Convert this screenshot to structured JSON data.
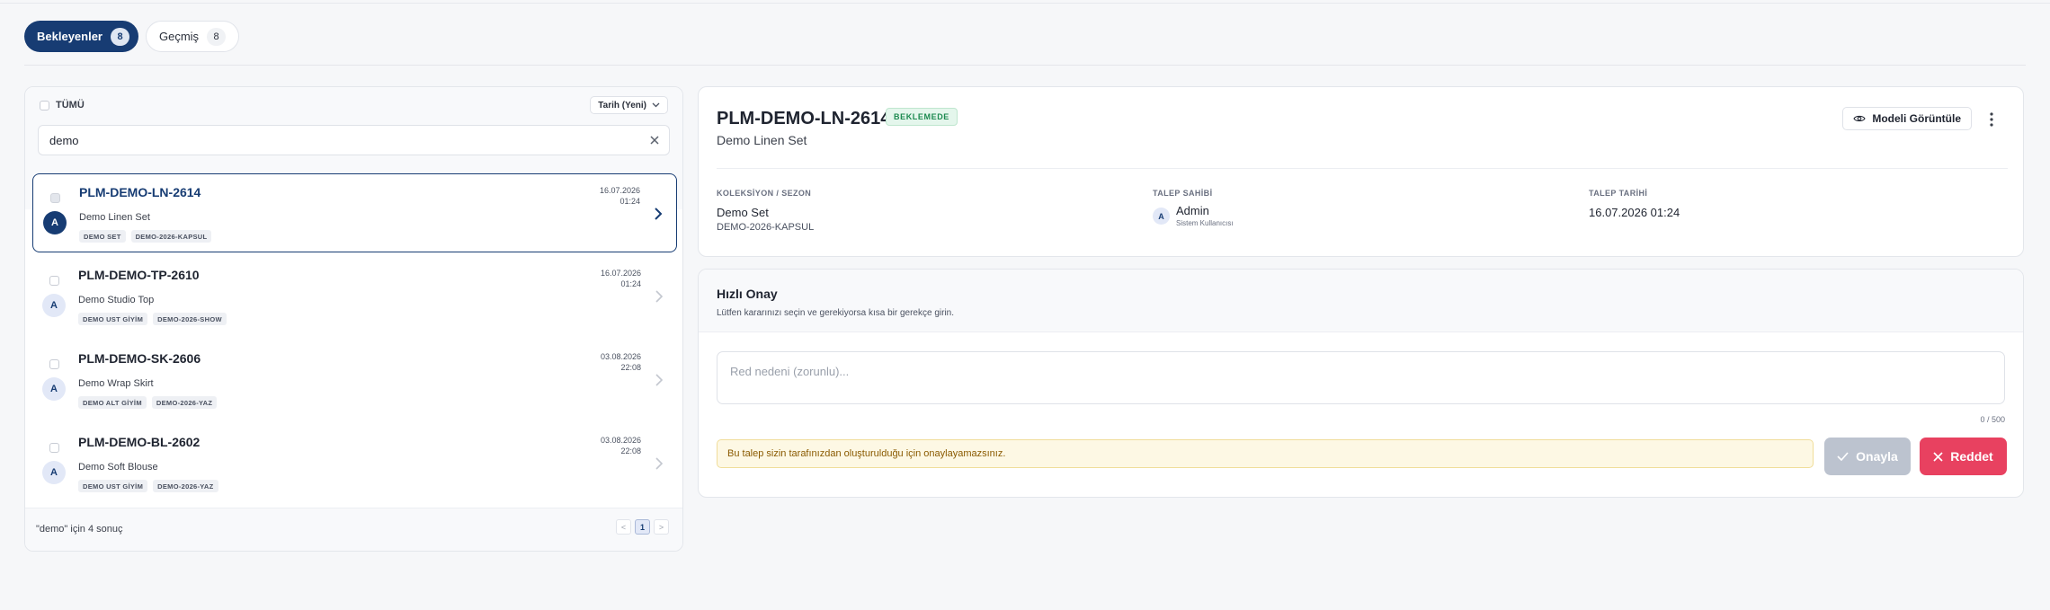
{
  "tabs": [
    {
      "label": "Bekleyenler",
      "count": "8"
    },
    {
      "label": "Geçmiş",
      "count": "8"
    }
  ],
  "list": {
    "select_all_label": "TÜMÜ",
    "sort_label": "Tarih (Yeni)",
    "search_value": "demo",
    "items": [
      {
        "code": "PLM-DEMO-LN-2614",
        "name": "Demo Linen Set",
        "tags": [
          "DEMO SET",
          "DEMO-2026-KAPSUL"
        ],
        "date": "16.07.2026",
        "time": "01:24",
        "avatar": "A"
      },
      {
        "code": "PLM-DEMO-TP-2610",
        "name": "Demo Studio Top",
        "tags": [
          "DEMO UST GİYİM",
          "DEMO-2026-SHOW"
        ],
        "date": "16.07.2026",
        "time": "01:24",
        "avatar": "A"
      },
      {
        "code": "PLM-DEMO-SK-2606",
        "name": "Demo Wrap Skirt",
        "tags": [
          "DEMO ALT GİYİM",
          "DEMO-2026-YAZ"
        ],
        "date": "03.08.2026",
        "time": "22:08",
        "avatar": "A"
      },
      {
        "code": "PLM-DEMO-BL-2602",
        "name": "Demo Soft Blouse",
        "tags": [
          "DEMO UST GİYİM",
          "DEMO-2026-YAZ"
        ],
        "date": "03.08.2026",
        "time": "22:08",
        "avatar": "A"
      }
    ],
    "result_text": "\"demo\" için 4 sonuç",
    "pager": {
      "prev": "<",
      "current": "1",
      "next": ">"
    }
  },
  "detail": {
    "code": "PLM-DEMO-LN-2614",
    "status": "BEKLEMEDE",
    "name": "Demo Linen Set",
    "view_model_label": "Modeli Görüntüle",
    "collection_label": "KOLEKSİYON / SEZON",
    "collection_value": "Demo Set",
    "collection_sub": "DEMO-2026-KAPSUL",
    "owner_label": "TALEP SAHİBİ",
    "owner_avatar": "A",
    "owner_name": "Admin",
    "owner_role": "Sistem Kullanıcısı",
    "date_label": "TALEP TARİHİ",
    "date_value": "16.07.2026 01:24"
  },
  "quick": {
    "title": "Hızlı Onay",
    "subtitle": "Lütfen kararınızı seçin ve gerekiyorsa kısa bir gerekçe girin.",
    "reason_placeholder": "Red nedeni (zorunlu)...",
    "char_count": "0 / 500",
    "warning": "Bu talep sizin tarafınızdan oluşturulduğu için onaylayamazsınız.",
    "approve_label": "Onayla",
    "reject_label": "Reddet"
  }
}
